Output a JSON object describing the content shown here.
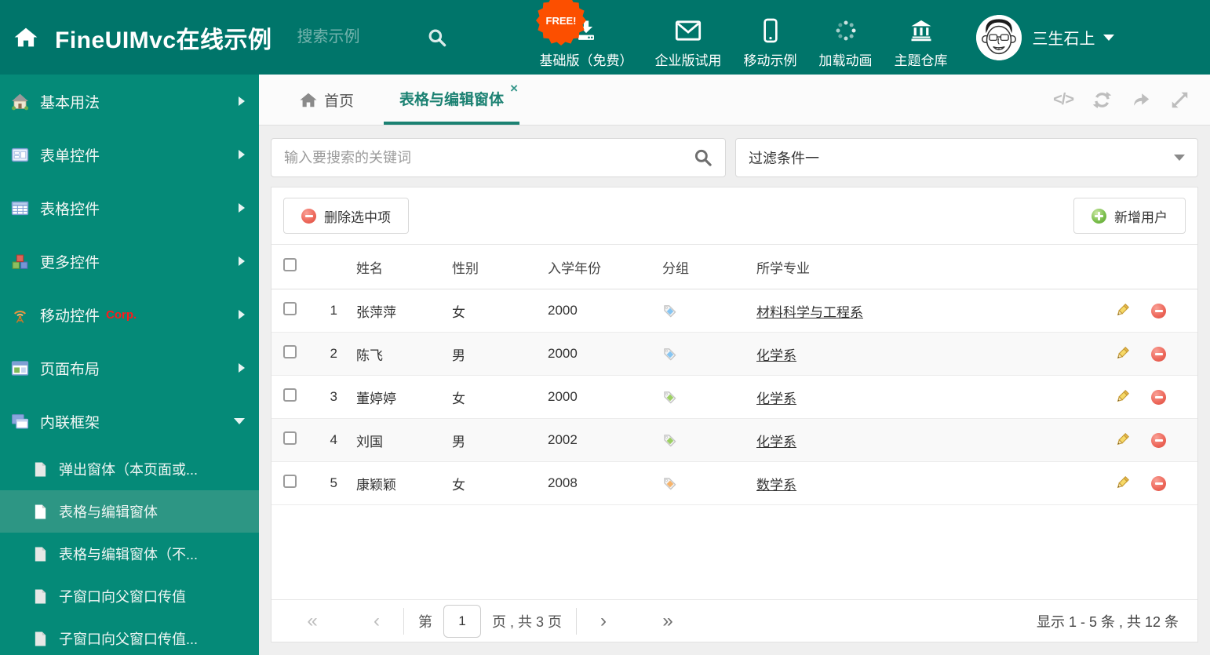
{
  "header": {
    "title": "FineUIMvc在线示例",
    "search_placeholder": "搜索示例",
    "free_badge": "FREE!",
    "nav_items": [
      {
        "label": "基础版（免费）",
        "icon": "download-icon"
      },
      {
        "label": "企业版试用",
        "icon": "envelope-icon"
      },
      {
        "label": "移动示例",
        "icon": "mobile-icon"
      },
      {
        "label": "加载动画",
        "icon": "spinner-icon"
      },
      {
        "label": "主题仓库",
        "icon": "bank-icon"
      }
    ],
    "user": {
      "name": "三生石上"
    }
  },
  "sidebar": {
    "items": [
      {
        "label": "基本用法"
      },
      {
        "label": "表单控件"
      },
      {
        "label": "表格控件"
      },
      {
        "label": "更多控件"
      },
      {
        "label": "移动控件",
        "badge": "Corp."
      },
      {
        "label": "页面布局"
      },
      {
        "label": "内联框架",
        "expanded": true
      }
    ],
    "subitems": [
      {
        "label": "弹出窗体（本页面或..."
      },
      {
        "label": "表格与编辑窗体",
        "active": true
      },
      {
        "label": "表格与编辑窗体（不..."
      },
      {
        "label": "子窗口向父窗口传值"
      },
      {
        "label": "子窗口向父窗口传值..."
      }
    ]
  },
  "tabs": {
    "home_label": "首页",
    "active_label": "表格与编辑窗体",
    "close_glyph": "×",
    "code_glyph": "</>"
  },
  "filters": {
    "search_placeholder": "输入要搜索的关键词",
    "dropdown_value": "过滤条件一"
  },
  "toolbar": {
    "delete_label": "删除选中项",
    "add_label": "新增用户"
  },
  "table": {
    "columns": {
      "name": "姓名",
      "gender": "性别",
      "year": "入学年份",
      "group": "分组",
      "major": "所学专业"
    },
    "rows": [
      {
        "num": "1",
        "name": "张萍萍",
        "gender": "女",
        "year": "2000",
        "tag_color": "#86c5f2",
        "major": "材料科学与工程系"
      },
      {
        "num": "2",
        "name": "陈飞",
        "gender": "男",
        "year": "2000",
        "tag_color": "#86c5f2",
        "major": "化学系"
      },
      {
        "num": "3",
        "name": "董婷婷",
        "gender": "女",
        "year": "2000",
        "tag_color": "#9ccf63",
        "major": "化学系"
      },
      {
        "num": "4",
        "name": "刘国",
        "gender": "男",
        "year": "2002",
        "tag_color": "#9ccf63",
        "major": "化学系"
      },
      {
        "num": "5",
        "name": "康颖颖",
        "gender": "女",
        "year": "2008",
        "tag_color": "#f6b36a",
        "major": "数学系"
      }
    ]
  },
  "pagination": {
    "page_prefix": "第",
    "page_value": "1",
    "page_suffix": "页 , 共 3 页",
    "first_glyph": "«",
    "prev_glyph": "‹",
    "next_glyph": "›",
    "last_glyph": "»",
    "summary": "显示 1 - 5 条 , 共 12 条"
  },
  "colors": {
    "header_teal": "#00756a",
    "sidebar_green": "#058a78",
    "selected_item_green": "#2d9684",
    "active_tab_teal": "#1b8172",
    "free_badge_orange": "#fc4f00",
    "delete_red": "#e9594c",
    "add_green": "#6fb545"
  }
}
